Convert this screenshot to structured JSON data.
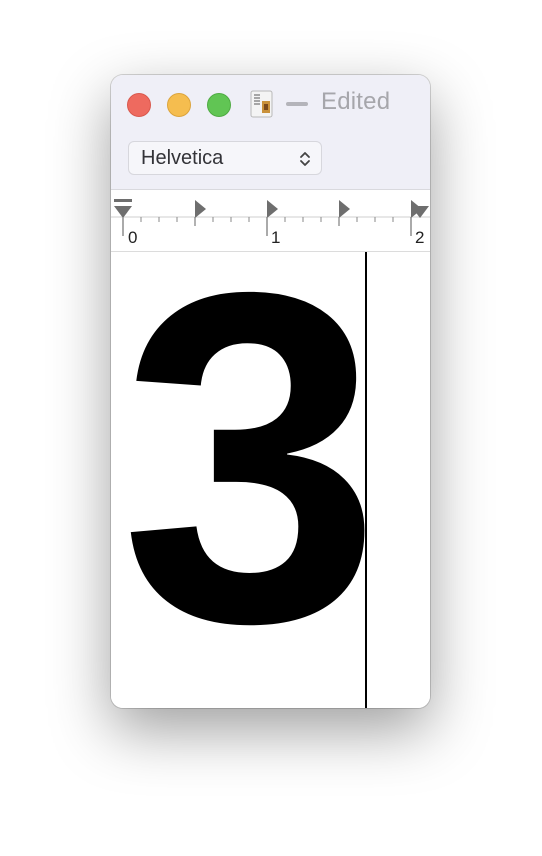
{
  "window": {
    "title_status": "Edited",
    "document_icon": "textedit-document-icon"
  },
  "traffic_lights": {
    "close_color": "#ee6a5f",
    "minimize_color": "#f5bd4f",
    "maximize_color": "#61c554"
  },
  "toolbar": {
    "font_family": "Helvetica",
    "font_popup_icon": "up-down-chevron-icon"
  },
  "ruler": {
    "labels": [
      "0",
      "1",
      "2"
    ],
    "marker_icons": [
      "tab-stop-icon",
      "indent-marker-icon"
    ]
  },
  "document": {
    "text": "3",
    "caret_visible": true
  }
}
